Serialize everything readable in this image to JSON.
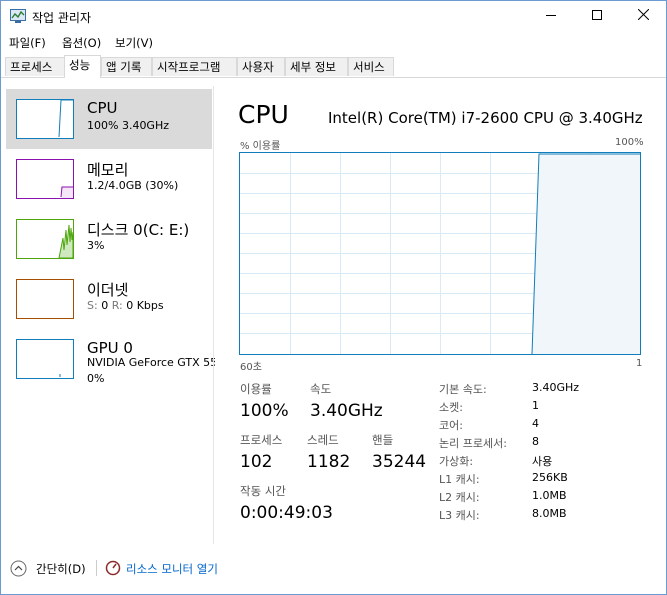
{
  "window": {
    "title": "작업 관리자"
  },
  "menu": [
    "파일(F)",
    "옵션(O)",
    "보기(V)"
  ],
  "tabs": [
    "프로세스",
    "성능",
    "앱 기록",
    "시작프로그램",
    "사용자",
    "세부 정보",
    "서비스"
  ],
  "active_tab": "성능",
  "sidebar": {
    "cpu": {
      "name": "CPU",
      "detail": "100% 3.40GHz"
    },
    "memory": {
      "name": "메모리",
      "detail": "1.2/4.0GB (30%)"
    },
    "disk": {
      "name": "디스크 0(C: E:)",
      "detail": "3%"
    },
    "ethernet": {
      "name": "이더넷",
      "detail_s_label": "S:",
      "detail_s": "0",
      "detail_r_label": "R:",
      "detail_r": "0 Kbps"
    },
    "gpu": {
      "name": "GPU 0",
      "model": "NVIDIA GeForce GTX 55",
      "detail": "0%"
    }
  },
  "main": {
    "title": "CPU",
    "model": "Intel(R) Core(TM) i7-2600 CPU @ 3.40GHz",
    "graph": {
      "top_left": "% 이용률",
      "top_right": "100%",
      "bottom_left": "60초",
      "bottom_right": "1"
    },
    "stats": {
      "utilization": {
        "label": "이용률",
        "value": "100%"
      },
      "speed": {
        "label": "속도",
        "value": "3.40GHz"
      },
      "processes": {
        "label": "프로세스",
        "value": "102"
      },
      "threads": {
        "label": "스레드",
        "value": "1182"
      },
      "handles": {
        "label": "핸들",
        "value": "35244"
      },
      "uptime": {
        "label": "작동 시간",
        "value": "0:00:49:03"
      }
    },
    "details": [
      {
        "label": "기본 속도:",
        "value": "3.40GHz"
      },
      {
        "label": "소켓:",
        "value": "1"
      },
      {
        "label": "코어:",
        "value": "4"
      },
      {
        "label": "논리 프로세서:",
        "value": "8"
      },
      {
        "label": "가상화:",
        "value": "사용"
      },
      {
        "label": "L1 캐시:",
        "value": "256KB"
      },
      {
        "label": "L2 캐시:",
        "value": "1.0MB"
      },
      {
        "label": "L3 캐시:",
        "value": "8.0MB"
      }
    ]
  },
  "footer": {
    "collapse_label": "간단히(D)",
    "resource_monitor_label": "리소스 모니터 열기"
  },
  "colors": {
    "cpu": "#117dbb",
    "memory": "#8b12ae",
    "disk": "#4da60c",
    "ethernet": "#a74f01",
    "gpu": "#117dbb"
  }
}
